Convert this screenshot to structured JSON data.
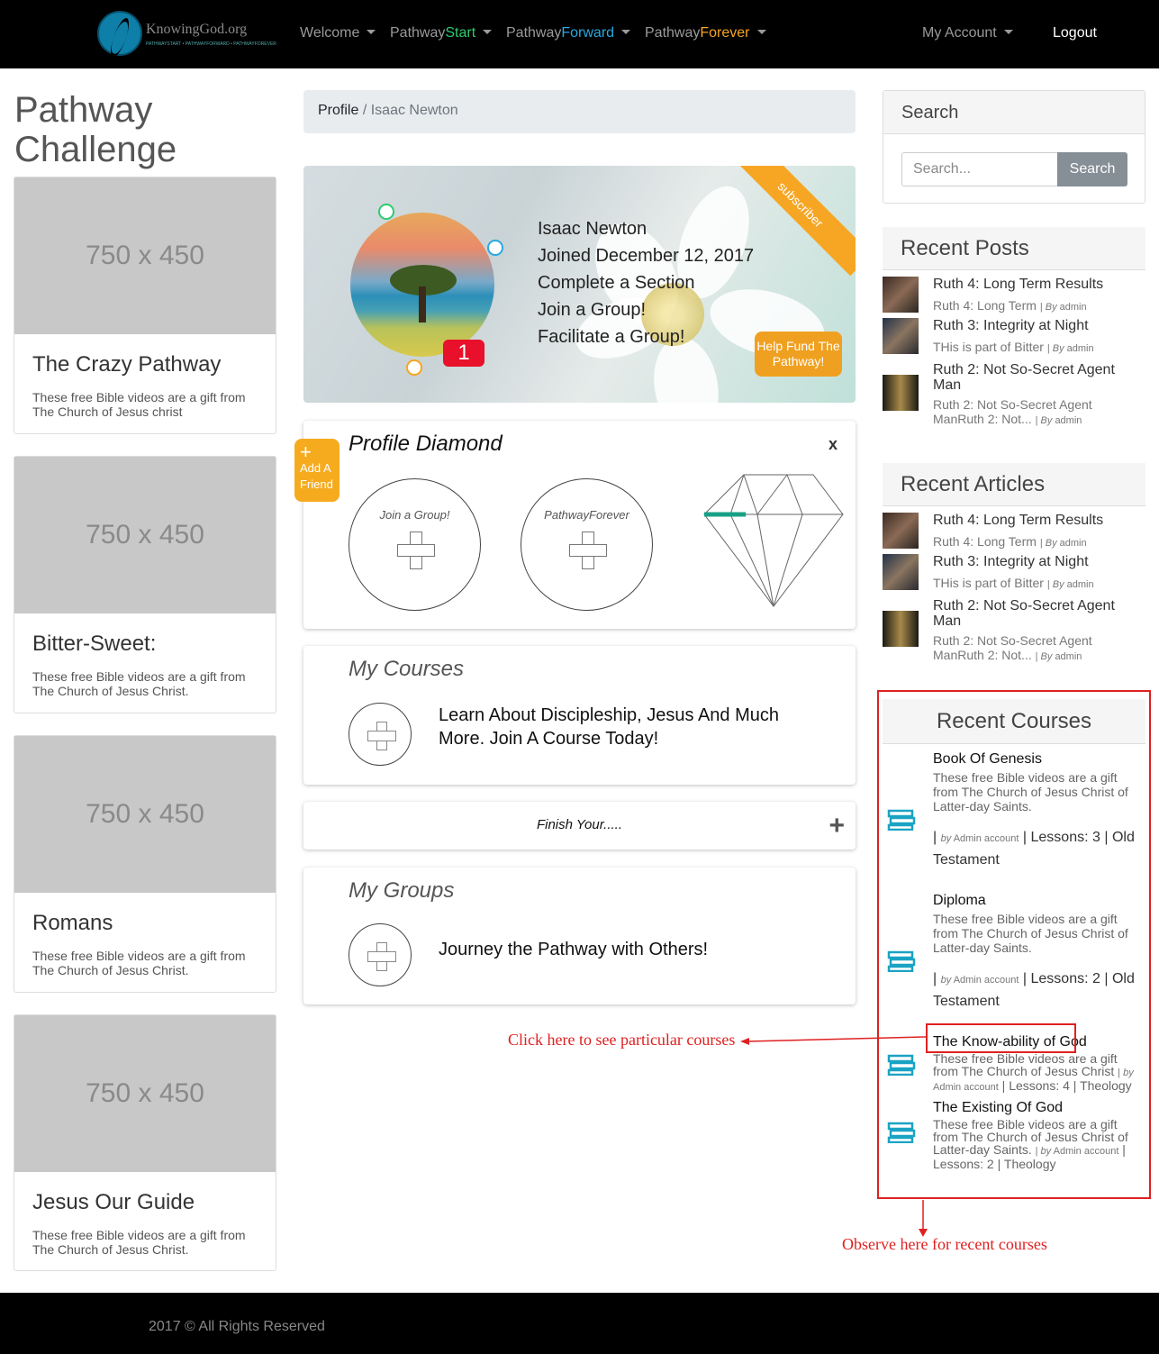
{
  "nav": {
    "logo_text": "KnowingGod.org",
    "logo_sub": "PATHWAYSTART • PATHWAYFORWARD • PATHWAYFOREVER",
    "items": [
      {
        "label": "Welcome"
      },
      {
        "prefix": "Pathway",
        "suffix": "Start"
      },
      {
        "prefix": "Pathway",
        "suffix": "Forward"
      },
      {
        "prefix": "Pathway",
        "suffix": "Forever"
      }
    ],
    "account": "My Account",
    "logout": "Logout"
  },
  "left": {
    "title": "Pathway Challenge",
    "cards": [
      {
        "placeholder": "750 x 450",
        "title": "The Crazy Pathway",
        "desc": "These free Bible videos are a gift from The Church of Jesus christ"
      },
      {
        "placeholder": "750 x 450",
        "title": "Bitter-Sweet:",
        "desc": "These free Bible videos are a gift from The Church of Jesus Christ."
      },
      {
        "placeholder": "750 x 450",
        "title": "Romans",
        "desc": "These free Bible videos are a gift from The Church of Jesus Christ."
      },
      {
        "placeholder": "750 x 450",
        "title": "Jesus Our Guide",
        "desc": "These free Bible videos are a gift from The Church of Jesus Christ."
      }
    ]
  },
  "breadcrumb": {
    "link": "Profile",
    "sep": "/",
    "current": "Isaac Newton"
  },
  "profile": {
    "name": "Isaac Newton",
    "joined": "Joined December 12, 2017",
    "line3": "Complete a Section",
    "line4": "Join a Group!",
    "line5": "Facilitate a Group!",
    "badge": "1",
    "ribbon": "subscriber",
    "fund_label": "Help Fund The Pathway!"
  },
  "diamond": {
    "title": "Profile Diamond",
    "close": "x",
    "add_friend_plus": "+",
    "add_friend": "Add A Friend",
    "circle1": "Join a Group!",
    "circle2": "PathwayForever",
    "progress": 0.15
  },
  "courses_panel": {
    "title": "My Courses",
    "text": "Learn About Discipleship, Jesus And Much More. Join A Course Today!"
  },
  "finish": {
    "text": "Finish Your.....",
    "plus": "+"
  },
  "groups_panel": {
    "title": "My Groups",
    "text": "Journey the Pathway with Others!"
  },
  "search": {
    "title": "Search",
    "placeholder": "Search...",
    "button": "Search"
  },
  "recent_posts": {
    "title": "Recent Posts",
    "items": [
      {
        "title": "Ruth 4: Long Term Results",
        "excerpt": "Ruth 4: Long Term",
        "by": "By",
        "author": "admin"
      },
      {
        "title": "Ruth 3: Integrity at Night",
        "excerpt": "THis is part of Bitter",
        "by": "By",
        "author": "admin"
      },
      {
        "title": "Ruth 2: Not So-Secret Agent Man",
        "excerpt": "Ruth 2: Not So-Secret Agent ManRuth 2: Not...",
        "by": "By",
        "author": "admin"
      }
    ]
  },
  "recent_articles": {
    "title": "Recent Articles",
    "items": [
      {
        "title": "Ruth 4: Long Term Results",
        "excerpt": "Ruth 4: Long Term",
        "by": "By",
        "author": "admin"
      },
      {
        "title": "Ruth 3: Integrity at Night",
        "excerpt": "THis is part of Bitter",
        "by": "By",
        "author": "admin"
      },
      {
        "title": "Ruth 2: Not So-Secret Agent Man",
        "excerpt": "Ruth 2: Not So-Secret Agent ManRuth 2: Not...",
        "by": "By",
        "author": "admin"
      }
    ]
  },
  "recent_courses": {
    "title": "Recent Courses",
    "items": [
      {
        "title": "Book Of Genesis",
        "desc": "These free Bible videos are a gift from The Church of Jesus Christ of Latter-day Saints.",
        "by": "by",
        "author": "Admin account",
        "lessons": "Lessons: 3",
        "category": "Old Testament"
      },
      {
        "title": "Diploma",
        "desc": "These free Bible videos are a gift from The Church of Jesus Christ of Latter-day Saints.",
        "by": "by",
        "author": "Admin account",
        "lessons": "Lessons: 2",
        "category": "Old Testament"
      },
      {
        "title": "The Know-ability of God",
        "desc": "These free Bible videos are a gift from The Church of Jesus Christ",
        "by": "by",
        "author": "Admin account",
        "lessons": "Lessons: 4",
        "category": "Theology"
      },
      {
        "title": "The Existing Of God",
        "desc": "These free Bible videos are a gift from The Church of Jesus Christ of Latter-day Saints.",
        "by": "by",
        "author": "Admin account",
        "lessons": "Lessons: 2",
        "category": "Theology"
      }
    ]
  },
  "annotations": {
    "click_here": "Click here to see particular courses",
    "observe_here": "Observe here for recent courses"
  },
  "footer": {
    "text": "2017 © All Rights Reserved"
  },
  "colors": {
    "start": "#2ecc71",
    "forward": "#29a9e0",
    "forever": "#f6a623",
    "annotation": "#e02020",
    "badge": "#e8102a"
  }
}
